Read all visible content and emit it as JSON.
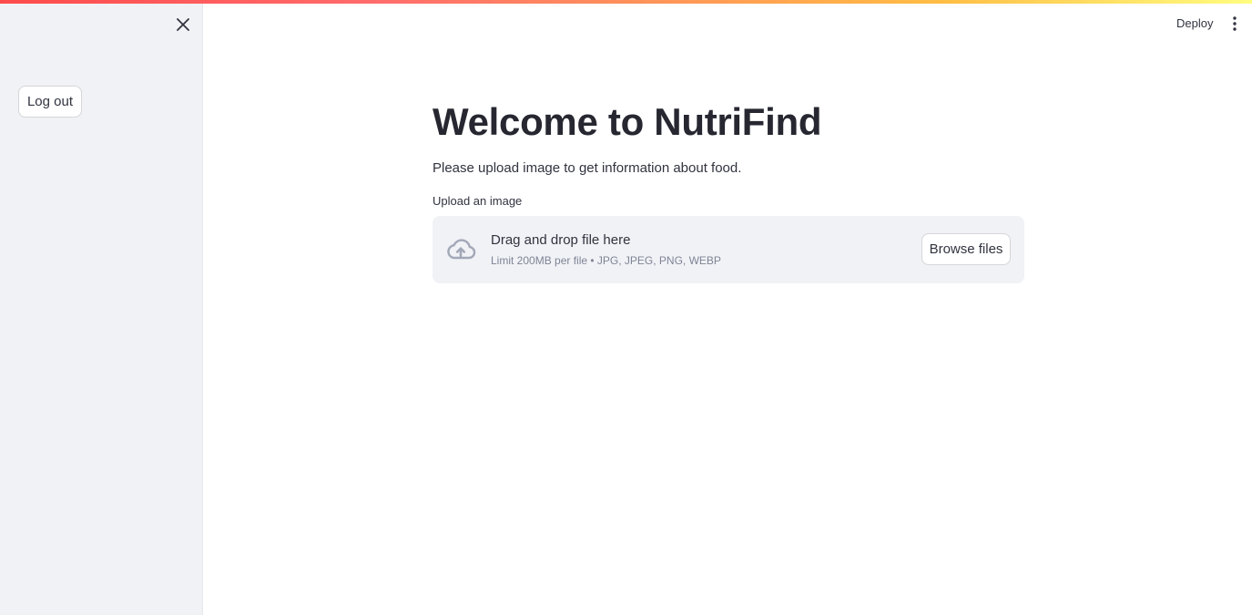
{
  "header": {
    "deploy_label": "Deploy",
    "menu_icon": "kebab-menu-icon"
  },
  "sidebar": {
    "close_icon": "close-icon",
    "logout_label": "Log out"
  },
  "main": {
    "title": "Welcome to NutriFind",
    "subtitle": "Please upload image to get information about food.",
    "uploader": {
      "label": "Upload an image",
      "icon": "cloud-upload-icon",
      "drop_text": "Drag and drop file here",
      "limit_text": "Limit 200MB per file • JPG, JPEG, PNG, WEBP",
      "browse_label": "Browse files"
    }
  },
  "colors": {
    "sidebar_bg": "#f0f2f6",
    "text": "#31333f",
    "muted_text": "#808495",
    "accent_gradient_start": "#ff4b4b",
    "accent_gradient_end": "#fffd80"
  }
}
